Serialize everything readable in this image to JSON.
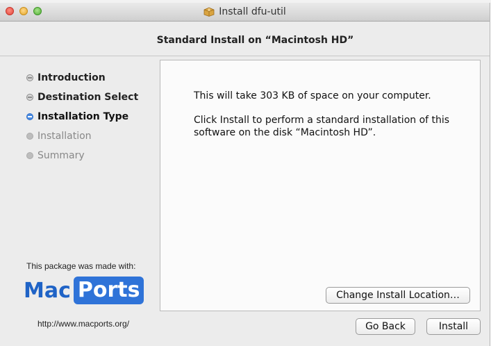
{
  "window": {
    "title": "Install dfu-util"
  },
  "heading": "Standard Install on “Macintosh HD”",
  "steps": [
    {
      "label": "Introduction",
      "state": "done"
    },
    {
      "label": "Destination Select",
      "state": "done"
    },
    {
      "label": "Installation Type",
      "state": "current"
    },
    {
      "label": "Installation",
      "state": "future"
    },
    {
      "label": "Summary",
      "state": "future"
    }
  ],
  "content": {
    "line1": "This will take 303 KB of space on your computer.",
    "line2": "Click Install to perform a standard installation of this software on the disk “Macintosh HD”."
  },
  "buttons": {
    "change_location": "Change Install Location…",
    "go_back": "Go Back",
    "install": "Install"
  },
  "branding": {
    "made_with": "This package was made with:",
    "logo_mac": "Mac",
    "logo_ports": "Ports",
    "url": "http://www.macports.org/"
  },
  "colors": {
    "accent": "#2f73d8",
    "step_current": "#4a8be0"
  },
  "icons": {
    "title_icon": "package-icon"
  }
}
